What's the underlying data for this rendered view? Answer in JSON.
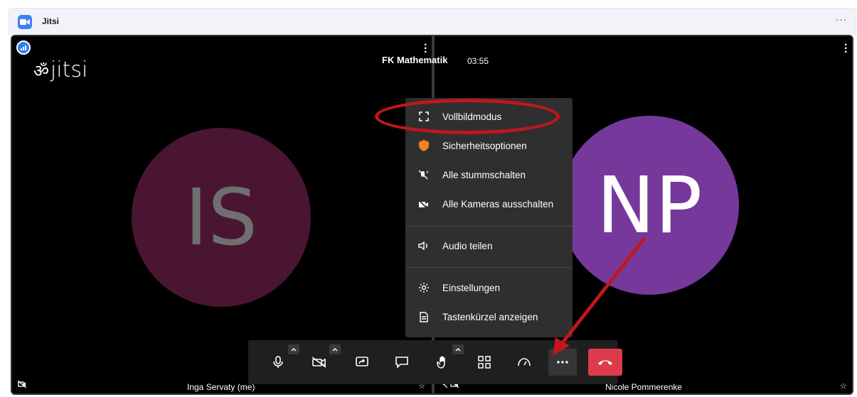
{
  "window": {
    "title": "Jitsi",
    "more_label": "···"
  },
  "meeting": {
    "subject": "FK Mathematik",
    "timer": "03:55",
    "logo_text": "jitsi"
  },
  "participants": [
    {
      "initials": "IS",
      "name": "Inga Servaty (me)",
      "avatar_color": "#4a1531"
    },
    {
      "initials": "NP",
      "name": "Nicole Pommerenke",
      "avatar_color": "#76399b"
    }
  ],
  "menu": {
    "items": [
      {
        "label": "Vollbildmodus",
        "icon": "fullscreen-icon"
      },
      {
        "label": "Sicherheitsoptionen",
        "icon": "shield-icon"
      },
      {
        "label": "Alle stummschalten",
        "icon": "mute-all-icon"
      },
      {
        "label": "Alle Kameras ausschalten",
        "icon": "cameras-off-icon"
      },
      {
        "label": "Audio teilen",
        "icon": "speaker-icon"
      },
      {
        "label": "Einstellungen",
        "icon": "gear-icon"
      },
      {
        "label": "Tastenkürzel anzeigen",
        "icon": "document-icon"
      }
    ]
  },
  "toolbar": {
    "buttons": [
      {
        "name": "microphone",
        "icon": "microphone-icon"
      },
      {
        "name": "camera",
        "icon": "camera-off-icon"
      },
      {
        "name": "share-screen",
        "icon": "share-screen-icon"
      },
      {
        "name": "chat",
        "icon": "chat-icon"
      },
      {
        "name": "raise-hand",
        "icon": "hand-icon"
      },
      {
        "name": "tile-view",
        "icon": "grid-icon"
      },
      {
        "name": "performance",
        "icon": "gauge-icon"
      },
      {
        "name": "more",
        "icon": "more-dots-icon"
      },
      {
        "name": "hangup",
        "icon": "hangup-icon"
      }
    ]
  },
  "colors": {
    "accent": "#2d7ff7",
    "hangup": "#dd3b4b",
    "annotation": "#c0161c"
  }
}
